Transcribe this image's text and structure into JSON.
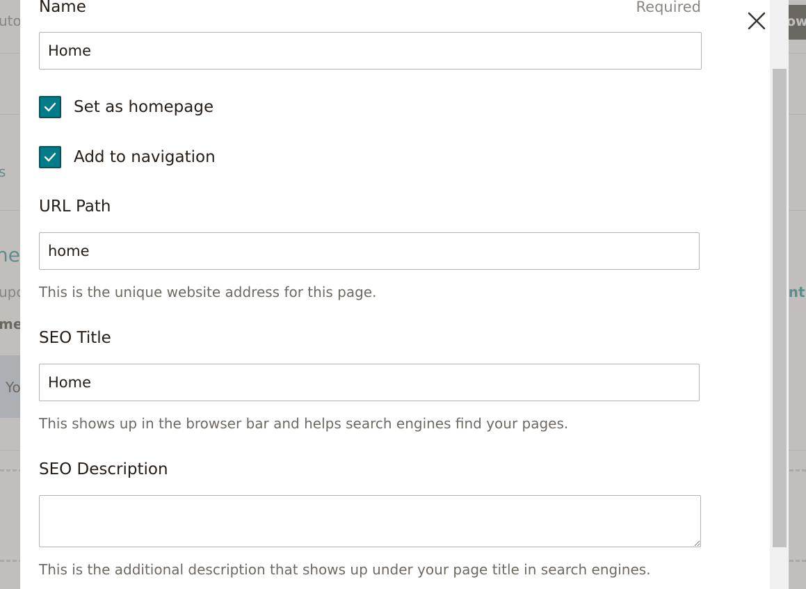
{
  "background": {
    "fragments": {
      "top_left": "uto",
      "mid_left_link": "s",
      "heading_fragment": "ne",
      "sub_fragment": "upc",
      "bold_fragment": "me",
      "banner_fragment": "Yo",
      "right_link": "ont",
      "top_right_button": "ow"
    }
  },
  "modal": {
    "name_field": {
      "label": "Name",
      "required_label": "Required",
      "value": "Home"
    },
    "checkboxes": [
      {
        "label": "Set as homepage",
        "checked": true
      },
      {
        "label": "Add to navigation",
        "checked": true
      }
    ],
    "url_path": {
      "label": "URL Path",
      "value": "home",
      "help": "This is the unique website address for this page."
    },
    "seo_title": {
      "label": "SEO Title",
      "value": "Home",
      "help": "This shows up in the browser bar and helps search engines find your pages."
    },
    "seo_description": {
      "label": "SEO Description",
      "value": "",
      "help": "This is the additional description that shows up under your page title in search engines."
    },
    "close_icon": "close-icon"
  },
  "colors": {
    "accent": "#007c89",
    "text": "#241c15",
    "muted": "#6e6863",
    "overlay": "#9b9692"
  }
}
